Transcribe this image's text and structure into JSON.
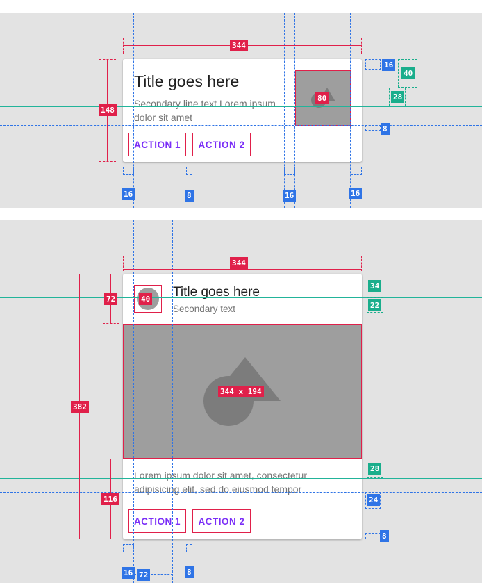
{
  "card1": {
    "title": "Title goes here",
    "secondary": "Secondary line text Lorem ipsum dolor sit amet",
    "actions": [
      "ACTION 1",
      "ACTION 2"
    ]
  },
  "card2": {
    "title": "Title goes here",
    "secondary": "Secondary text",
    "body": "Lorem ipsum dolor sit amet, consectetur adipisicing elit, sed do eiusmod tempor",
    "actions": [
      "ACTION 1",
      "ACTION 2"
    ]
  },
  "measurements1": {
    "width": "344",
    "height": "148",
    "thumb": "80",
    "top_pad": "16",
    "title_baseline": "40",
    "sec_baseline": "28",
    "bottom_gap": "8",
    "left_pad": "16",
    "btn_gap": "8",
    "thumb_gap": "16",
    "right_pad": "16"
  },
  "measurements2": {
    "width": "344",
    "height": "382",
    "header": "72",
    "avatar": "40",
    "media": "344 x 194",
    "body": "116",
    "title_baseline": "34",
    "sec_baseline": "22",
    "body_baseline": "28",
    "body_bottom": "24",
    "bottom_gap": "8",
    "left_pad": "16",
    "text_left": "72",
    "btn_gap": "8"
  },
  "colors": {
    "measure_red": "#e0204a",
    "keyline_blue": "#2f74e6",
    "baseline_green": "#1aae8c",
    "action_purple": "#7b2ff7",
    "background": "#e3e3e3"
  }
}
